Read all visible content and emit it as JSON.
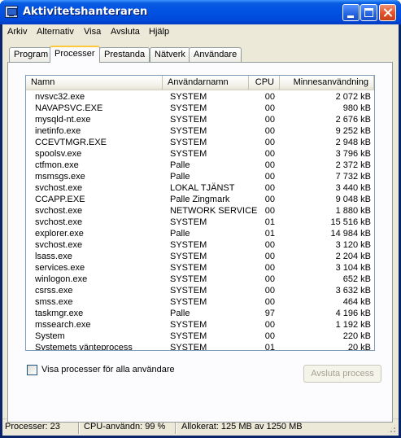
{
  "window": {
    "title": "Aktivitetshanteraren",
    "accent": "#0054e3"
  },
  "menu": [
    "Arkiv",
    "Alternativ",
    "Visa",
    "Avsluta",
    "Hjälp"
  ],
  "tabs": [
    {
      "label": "Program",
      "active": false
    },
    {
      "label": "Processer",
      "active": true
    },
    {
      "label": "Prestanda",
      "active": false
    },
    {
      "label": "Nätverk",
      "active": false
    },
    {
      "label": "Användare",
      "active": false
    }
  ],
  "processes": {
    "columns": {
      "name": "Namn",
      "user": "Användarnamn",
      "cpu": "CPU",
      "mem": "Minnesanvändning"
    },
    "rows": [
      {
        "name": "nvsvc32.exe",
        "user": "SYSTEM",
        "cpu": "00",
        "mem": "2 072 kB"
      },
      {
        "name": "NAVAPSVC.EXE",
        "user": "SYSTEM",
        "cpu": "00",
        "mem": "980 kB"
      },
      {
        "name": "mysqld-nt.exe",
        "user": "SYSTEM",
        "cpu": "00",
        "mem": "2 676 kB"
      },
      {
        "name": "inetinfo.exe",
        "user": "SYSTEM",
        "cpu": "00",
        "mem": "9 252 kB"
      },
      {
        "name": "CCEVTMGR.EXE",
        "user": "SYSTEM",
        "cpu": "00",
        "mem": "2 948 kB"
      },
      {
        "name": "spoolsv.exe",
        "user": "SYSTEM",
        "cpu": "00",
        "mem": "3 796 kB"
      },
      {
        "name": "ctfmon.exe",
        "user": "Palle",
        "cpu": "00",
        "mem": "2 372 kB"
      },
      {
        "name": "msmsgs.exe",
        "user": "Palle",
        "cpu": "00",
        "mem": "7 732 kB"
      },
      {
        "name": "svchost.exe",
        "user": "LOKAL TJÄNST",
        "cpu": "00",
        "mem": "3 440 kB"
      },
      {
        "name": "CCAPP.EXE",
        "user": "Palle Zingmark",
        "cpu": "00",
        "mem": "9 048 kB"
      },
      {
        "name": "svchost.exe",
        "user": "NETWORK SERVICE",
        "cpu": "00",
        "mem": "1 880 kB"
      },
      {
        "name": "svchost.exe",
        "user": "SYSTEM",
        "cpu": "01",
        "mem": "15 516 kB"
      },
      {
        "name": "explorer.exe",
        "user": "Palle",
        "cpu": "01",
        "mem": "14 984 kB"
      },
      {
        "name": "svchost.exe",
        "user": "SYSTEM",
        "cpu": "00",
        "mem": "3 120 kB"
      },
      {
        "name": "lsass.exe",
        "user": "SYSTEM",
        "cpu": "00",
        "mem": "2 204 kB"
      },
      {
        "name": "services.exe",
        "user": "SYSTEM",
        "cpu": "00",
        "mem": "3 104 kB"
      },
      {
        "name": "winlogon.exe",
        "user": "SYSTEM",
        "cpu": "00",
        "mem": "652 kB"
      },
      {
        "name": "csrss.exe",
        "user": "SYSTEM",
        "cpu": "00",
        "mem": "3 632 kB"
      },
      {
        "name": "smss.exe",
        "user": "SYSTEM",
        "cpu": "00",
        "mem": "464 kB"
      },
      {
        "name": "taskmgr.exe",
        "user": "Palle",
        "cpu": "97",
        "mem": "4 196 kB"
      },
      {
        "name": "mssearch.exe",
        "user": "SYSTEM",
        "cpu": "00",
        "mem": "1 192 kB"
      },
      {
        "name": "System",
        "user": "SYSTEM",
        "cpu": "00",
        "mem": "220 kB"
      },
      {
        "name": "Systemets vänteprocess",
        "user": "SYSTEM",
        "cpu": "01",
        "mem": "20 kB"
      }
    ]
  },
  "show_all_processes": {
    "label": "Visa processer för alla användare",
    "checked": false
  },
  "end_process_button": {
    "label": "Avsluta process",
    "enabled": false
  },
  "statusbar": {
    "processes": "Processer: 23",
    "cpu": "CPU-användn: 99 %",
    "commit": "Allokerat: 125 MB av 1250 MB"
  }
}
